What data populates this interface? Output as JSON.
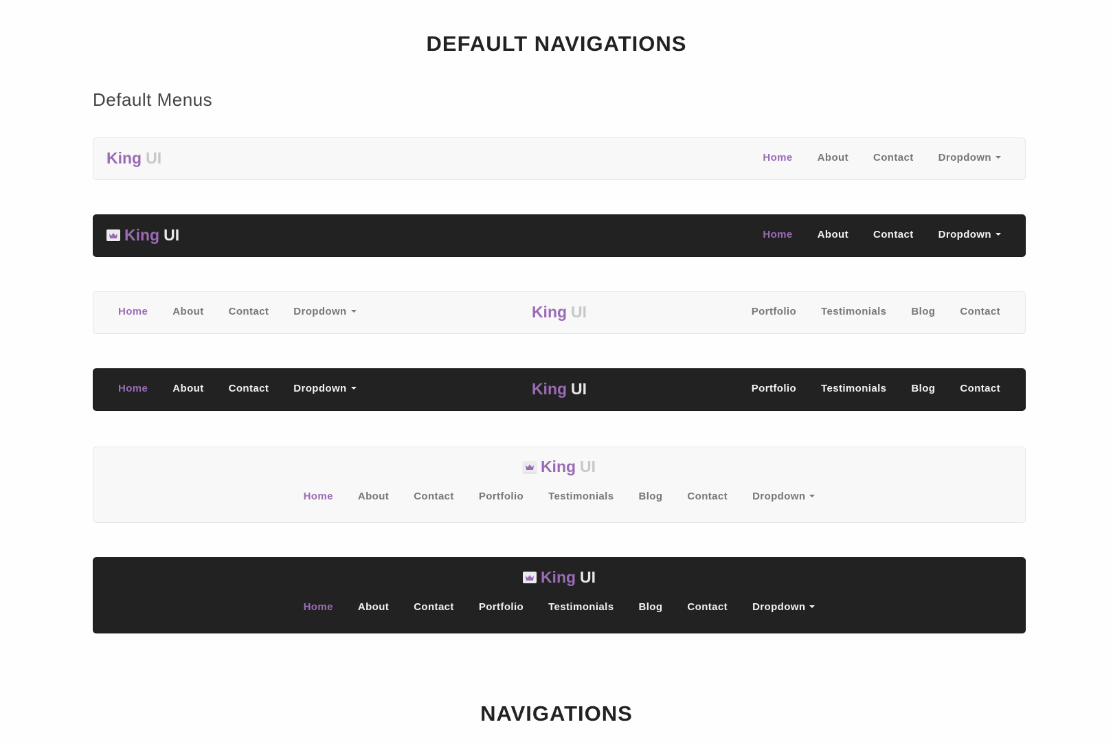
{
  "page": {
    "title": "DEFAULT NAVIGATIONS",
    "section_title": "Default Menus",
    "bottom_title": "NAVIGATIONS"
  },
  "brand": {
    "part1": "King",
    "part2": "UI",
    "icon": "crown-icon",
    "accent_color": "#9b6bb5"
  },
  "navbars": [
    {
      "variant": "light",
      "layout": "brand-left-links-right",
      "has_icon": false,
      "links": [
        {
          "label": "Home",
          "active": true
        },
        {
          "label": "About"
        },
        {
          "label": "Contact"
        },
        {
          "label": "Dropdown",
          "dropdown": true
        }
      ]
    },
    {
      "variant": "dark",
      "layout": "brand-left-links-right",
      "has_icon": true,
      "links": [
        {
          "label": "Home",
          "active": true
        },
        {
          "label": "About"
        },
        {
          "label": "Contact"
        },
        {
          "label": "Dropdown",
          "dropdown": true
        }
      ]
    },
    {
      "variant": "light",
      "layout": "brand-center-split",
      "has_icon": false,
      "left_links": [
        {
          "label": "Home",
          "active": true
        },
        {
          "label": "About"
        },
        {
          "label": "Contact"
        },
        {
          "label": "Dropdown",
          "dropdown": true
        }
      ],
      "right_links": [
        {
          "label": "Portfolio"
        },
        {
          "label": "Testimonials"
        },
        {
          "label": "Blog"
        },
        {
          "label": "Contact"
        }
      ]
    },
    {
      "variant": "dark",
      "layout": "brand-center-split",
      "has_icon": false,
      "left_links": [
        {
          "label": "Home",
          "active": true
        },
        {
          "label": "About"
        },
        {
          "label": "Contact"
        },
        {
          "label": "Dropdown",
          "dropdown": true
        }
      ],
      "right_links": [
        {
          "label": "Portfolio"
        },
        {
          "label": "Testimonials"
        },
        {
          "label": "Blog"
        },
        {
          "label": "Contact"
        }
      ]
    },
    {
      "variant": "light",
      "layout": "brand-stacked-center",
      "has_icon": true,
      "links": [
        {
          "label": "Home",
          "active": true
        },
        {
          "label": "About"
        },
        {
          "label": "Contact"
        },
        {
          "label": "Portfolio"
        },
        {
          "label": "Testimonials"
        },
        {
          "label": "Blog"
        },
        {
          "label": "Contact"
        },
        {
          "label": "Dropdown",
          "dropdown": true
        }
      ]
    },
    {
      "variant": "dark",
      "layout": "brand-stacked-center",
      "has_icon": true,
      "links": [
        {
          "label": "Home",
          "active": true
        },
        {
          "label": "About"
        },
        {
          "label": "Contact"
        },
        {
          "label": "Portfolio"
        },
        {
          "label": "Testimonials"
        },
        {
          "label": "Blog"
        },
        {
          "label": "Contact"
        },
        {
          "label": "Dropdown",
          "dropdown": true
        }
      ]
    }
  ]
}
